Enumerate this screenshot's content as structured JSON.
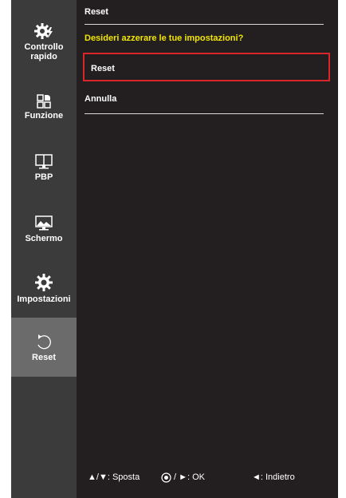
{
  "sidebar": {
    "items": [
      {
        "label": "Controllo rapido",
        "icon": "quick-settings-icon",
        "active": false
      },
      {
        "label": "Funzione",
        "icon": "function-icon",
        "active": false
      },
      {
        "label": "PBP",
        "icon": "pbp-icon",
        "active": false
      },
      {
        "label": "Schermo",
        "icon": "picture-icon",
        "active": false
      },
      {
        "label": "Impostazioni",
        "icon": "settings-gear-icon",
        "active": false
      },
      {
        "label": "Reset",
        "icon": "reset-icon",
        "active": true
      }
    ]
  },
  "main": {
    "title": "Reset",
    "question": "Desideri azzerare le tue impostazioni?",
    "options": [
      {
        "label": "Reset",
        "selected": true
      },
      {
        "label": "Annulla",
        "selected": false
      }
    ]
  },
  "footer": {
    "move": "▲/▼: Sposta",
    "ok": "/ ►: OK",
    "back": "◄: Indietro"
  },
  "colors": {
    "background": "#231f20",
    "sidebar": "#3b3b3b",
    "sidebar_active": "#6b6b6b",
    "question": "#f2e500",
    "selection_border": "#d8262b"
  }
}
